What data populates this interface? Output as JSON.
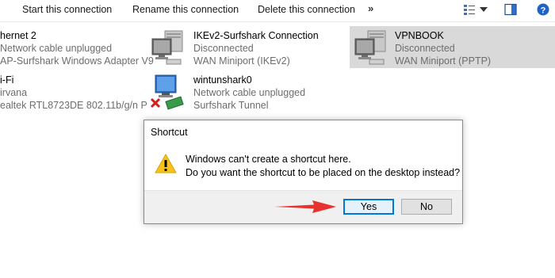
{
  "toolbar": {
    "start_label": "Start this connection",
    "rename_label": "Rename this connection",
    "delete_label": "Delete this connection",
    "more_label": "»"
  },
  "connections": [
    {
      "name": "hernet 2",
      "status": "Network cable unplugged",
      "device": "AP-Surfshark Windows Adapter V9"
    },
    {
      "name": "IKEv2-Surfshark Connection",
      "status": "Disconnected",
      "device": "WAN Miniport (IKEv2)"
    },
    {
      "name": "VPNBOOK",
      "status": "Disconnected",
      "device": "WAN Miniport (PPTP)"
    },
    {
      "name": "i-Fi",
      "status": "irvana",
      "device": "ealtek RTL8723DE 802.11b/g/n P"
    },
    {
      "name": "wintunshark0",
      "status": "Network cable unplugged",
      "device": "Surfshark Tunnel"
    }
  ],
  "dialog": {
    "title": "Shortcut",
    "message_line1": "Windows can't create a shortcut here.",
    "message_line2": "Do you want the shortcut to be placed on the desktop instead?",
    "yes_label": "Yes",
    "no_label": "No",
    "icon": "warning-icon"
  },
  "colors": {
    "accent": "#0078d7",
    "annotation_arrow": "#e8322d",
    "warning": "#f7c21b",
    "selected_bg": "#d9d9d9"
  }
}
